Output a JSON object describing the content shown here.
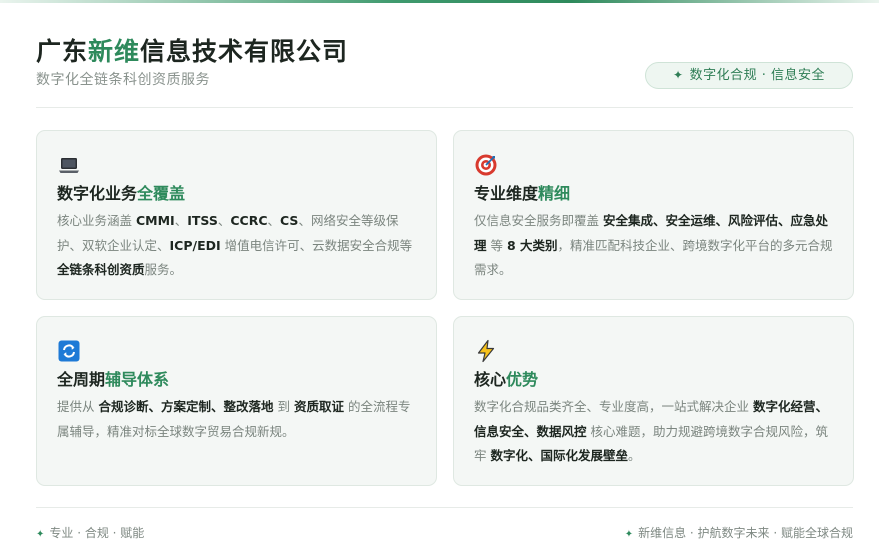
{
  "header": {
    "title_pre": "广东",
    "title_accent": "新维",
    "title_post": "信息技术有限公司",
    "subtitle": "数字化全链条科创资质服务",
    "badge": "数字化合规 · 信息安全"
  },
  "cards": [
    {
      "icon": "laptop-icon",
      "title_pre": "数字化业务",
      "title_accent": "全覆盖",
      "text": [
        {
          "t": "核心业务涵盖 "
        },
        {
          "t": "CMMI",
          "b": true
        },
        {
          "t": "、"
        },
        {
          "t": "ITSS",
          "b": true
        },
        {
          "t": "、"
        },
        {
          "t": "CCRC",
          "b": true
        },
        {
          "t": "、"
        },
        {
          "t": "CS",
          "b": true
        },
        {
          "t": "、网络安全等级保护、双软企业认定、"
        },
        {
          "t": "ICP/EDI",
          "b": true
        },
        {
          "t": " 增值电信许可、云数据安全合规等"
        },
        {
          "t": "全链条科创资质",
          "b": true
        },
        {
          "t": "服务。"
        }
      ]
    },
    {
      "icon": "target-icon",
      "title_pre": "专业维度",
      "title_accent": "精细",
      "text": [
        {
          "t": "仅信息安全服务即覆盖 "
        },
        {
          "t": "安全集成、安全运维、风险评估、应急处理",
          "b": true
        },
        {
          "t": " 等 "
        },
        {
          "t": "8 大类别",
          "b": true
        },
        {
          "t": "，精准匹配科技企业、跨境数字化平台的多元合规需求。"
        }
      ]
    },
    {
      "icon": "refresh-icon",
      "title_pre": "全周期",
      "title_accent": "辅导体系",
      "text": [
        {
          "t": "提供从 "
        },
        {
          "t": "合规诊断、方案定制、整改落地",
          "b": true
        },
        {
          "t": " 到 "
        },
        {
          "t": "资质取证",
          "b": true
        },
        {
          "t": " 的全流程专属辅导，精准对标全球数字贸易合规新规。"
        }
      ]
    },
    {
      "icon": "lightning-icon",
      "title_pre": "核心",
      "title_accent": "优势",
      "text": [
        {
          "t": "数字化合规品类齐全、专业度高，一站式解决企业 "
        },
        {
          "t": "数字化经营、信息安全、数据风控",
          "b": true
        },
        {
          "t": " 核心难题，助力规避跨境数字合规风险，筑牢 "
        },
        {
          "t": "数字化、国际化发展壁垒",
          "b": true
        },
        {
          "t": "。"
        }
      ]
    }
  ],
  "footer": {
    "left": "专业 · 合规 · 赋能",
    "right": "新维信息 · 护航数字未来 · 赋能全球合规"
  },
  "colors": {
    "accent": "#2e8a5c",
    "card_bg": "#f4f7f5",
    "badge_bg": "#eef6f1"
  }
}
